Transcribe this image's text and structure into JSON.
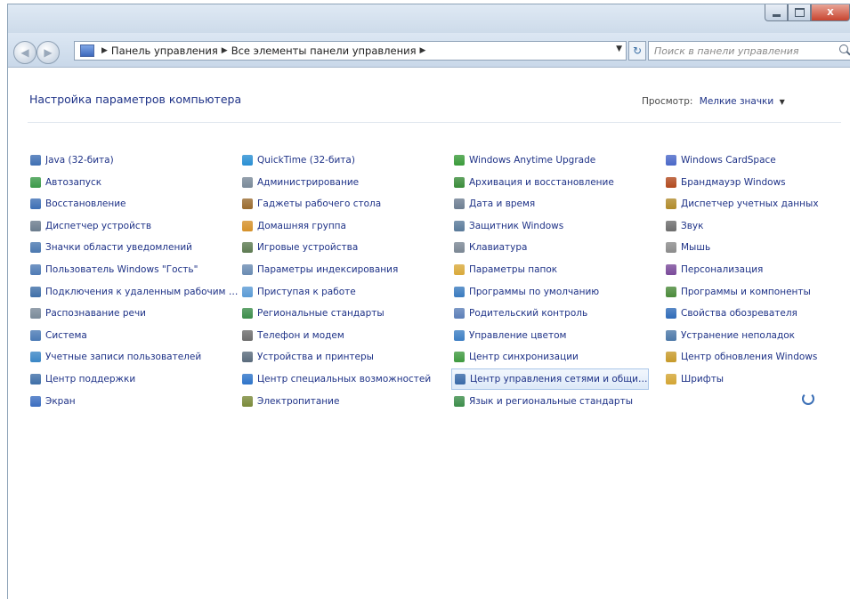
{
  "window": {
    "buttons": {
      "minimize": "",
      "maximize": "",
      "close": "X"
    }
  },
  "address": {
    "crumbs": [
      "Панель управления",
      "Все элементы панели управления"
    ],
    "refresh_icon": "refresh-icon"
  },
  "search": {
    "placeholder": "Поиск в панели управления"
  },
  "content": {
    "title": "Настройка параметров компьютера",
    "viewby_label": "Просмотр:",
    "viewby_value": "Мелкие значки"
  },
  "items": [
    {
      "label": "Java (32-бита)",
      "icon": "java-icon",
      "color": "#3f6fb3"
    },
    {
      "label": "QuickTime (32-бита)",
      "icon": "quicktime-icon",
      "color": "#2a8fd3"
    },
    {
      "label": "Windows Anytime Upgrade",
      "icon": "upgrade-icon",
      "color": "#3a9b3a"
    },
    {
      "label": "Windows CardSpace",
      "icon": "cardspace-icon",
      "color": "#4a68c8"
    },
    {
      "label": "Автозапуск",
      "icon": "autoplay-icon",
      "color": "#3b9a49"
    },
    {
      "label": "Администрирование",
      "icon": "admin-tools-icon",
      "color": "#7a8a99"
    },
    {
      "label": "Архивация и восстановление",
      "icon": "backup-icon",
      "color": "#3a8c3a"
    },
    {
      "label": "Брандмауэр Windows",
      "icon": "firewall-icon",
      "color": "#b24a1f"
    },
    {
      "label": "Восстановление",
      "icon": "recovery-icon",
      "color": "#3d6fb5"
    },
    {
      "label": "Гаджеты рабочего стола",
      "icon": "gadgets-icon",
      "color": "#9a6b2f"
    },
    {
      "label": "Дата и время",
      "icon": "datetime-icon",
      "color": "#6d7e92"
    },
    {
      "label": "Диспетчер учетных данных",
      "icon": "credentials-icon",
      "color": "#b08a2a"
    },
    {
      "label": "Диспетчер устройств",
      "icon": "device-manager-icon",
      "color": "#6b7c8d"
    },
    {
      "label": "Домашняя группа",
      "icon": "homegroup-icon",
      "color": "#d5912a"
    },
    {
      "label": "Защитник Windows",
      "icon": "defender-icon",
      "color": "#5a7a9a"
    },
    {
      "label": "Звук",
      "icon": "sound-icon",
      "color": "#6d6d6d"
    },
    {
      "label": "Значки области уведомлений",
      "icon": "notification-icon",
      "color": "#4a78b0"
    },
    {
      "label": "Игровые устройства",
      "icon": "game-controllers-icon",
      "color": "#5d7b52"
    },
    {
      "label": "Клавиатура",
      "icon": "keyboard-icon",
      "color": "#7b8794"
    },
    {
      "label": "Мышь",
      "icon": "mouse-icon",
      "color": "#8b8b8b"
    },
    {
      "label": "Пользователь Windows \"Гость\"",
      "icon": "user-icon",
      "color": "#4f7bb5"
    },
    {
      "label": "Параметры индексирования",
      "icon": "indexing-icon",
      "color": "#6a8bb2"
    },
    {
      "label": "Параметры папок",
      "icon": "folder-options-icon",
      "color": "#d9a93a"
    },
    {
      "label": "Персонализация",
      "icon": "personalization-icon",
      "color": "#7a4a9a"
    },
    {
      "label": "Подключения к удаленным рабочим столам",
      "icon": "remote-icon",
      "color": "#3f6fa8"
    },
    {
      "label": "Приступая к работе",
      "icon": "getting-started-icon",
      "color": "#5b9bd5"
    },
    {
      "label": "Программы по умолчанию",
      "icon": "default-programs-icon",
      "color": "#3a7bbf"
    },
    {
      "label": "Программы и компоненты",
      "icon": "programs-icon",
      "color": "#4a8a3a"
    },
    {
      "label": "Распознавание речи",
      "icon": "speech-icon",
      "color": "#7a8a99"
    },
    {
      "label": "Региональные стандарты",
      "icon": "region-icon",
      "color": "#3c8d4a"
    },
    {
      "label": "Родительский контроль",
      "icon": "parental-icon",
      "color": "#5c7fb8"
    },
    {
      "label": "Свойства обозревателя",
      "icon": "internet-options-icon",
      "color": "#2f6bb8"
    },
    {
      "label": "Система",
      "icon": "system-icon",
      "color": "#4a7ab5"
    },
    {
      "label": "Телефон и модем",
      "icon": "phone-icon",
      "color": "#6d6d6d"
    },
    {
      "label": "Управление цветом",
      "icon": "color-management-icon",
      "color": "#3d7fc4"
    },
    {
      "label": "Устранение неполадок",
      "icon": "troubleshooting-icon",
      "color": "#4c78a8"
    },
    {
      "label": "Учетные записи пользователей",
      "icon": "user-accounts-icon",
      "color": "#3a86c6"
    },
    {
      "label": "Устройства и принтеры",
      "icon": "printers-icon",
      "color": "#5a6b7c"
    },
    {
      "label": "Центр синхронизации",
      "icon": "sync-icon",
      "color": "#3f9a3f"
    },
    {
      "label": "Центр обновления Windows",
      "icon": "windows-update-icon",
      "color": "#c79a2a"
    },
    {
      "label": "Центр поддержки",
      "icon": "action-center-icon",
      "color": "#3f6fa8"
    },
    {
      "label": "Центр специальных возможностей",
      "icon": "ease-of-access-icon",
      "color": "#2e74c9"
    },
    {
      "label": "Центр управления сетями и общим доступом",
      "icon": "network-icon",
      "color": "#3a6aa8"
    },
    {
      "label": "Шрифты",
      "icon": "fonts-icon",
      "color": "#d3a533"
    },
    {
      "label": "Экран",
      "icon": "display-icon",
      "color": "#3c6ec0"
    },
    {
      "label": "Электропитание",
      "icon": "power-icon",
      "color": "#7a8a3a"
    },
    {
      "label": "Язык и региональные стандарты",
      "icon": "language-icon",
      "color": "#3c8d4a"
    }
  ]
}
